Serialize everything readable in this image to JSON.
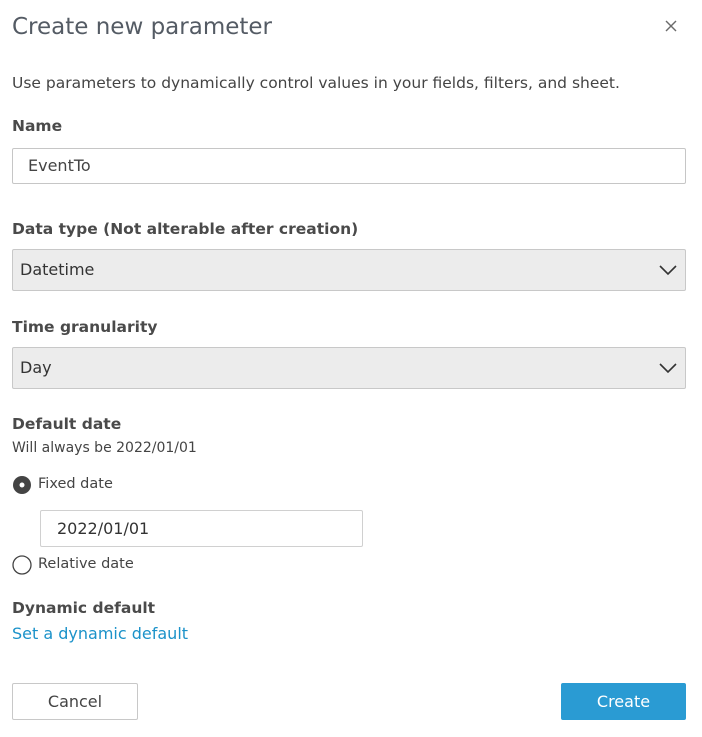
{
  "dialog": {
    "title": "Create new parameter",
    "close_icon": "close-icon",
    "description": "Use parameters to dynamically control values in your fields, filters, and sheet."
  },
  "name": {
    "label": "Name",
    "value": "EventTo"
  },
  "data_type": {
    "label": "Data type (Not alterable after creation)",
    "value": "Datetime",
    "icon": "chevron-down-icon"
  },
  "time_granularity": {
    "label": "Time granularity",
    "value": "Day",
    "icon": "chevron-down-icon"
  },
  "default_date": {
    "label": "Default date",
    "hint": "Will always be 2022/01/01",
    "options": [
      {
        "label": "Fixed date",
        "selected": true
      },
      {
        "label": "Relative date",
        "selected": false
      }
    ],
    "date_value": "2022/01/01"
  },
  "dynamic_default": {
    "label": "Dynamic default",
    "link": "Set a dynamic default"
  },
  "footer": {
    "cancel_label": "Cancel",
    "create_label": "Create"
  },
  "colors": {
    "accent": "#2a9bd3",
    "link": "#1b92c9",
    "select_bg": "#ececec"
  }
}
